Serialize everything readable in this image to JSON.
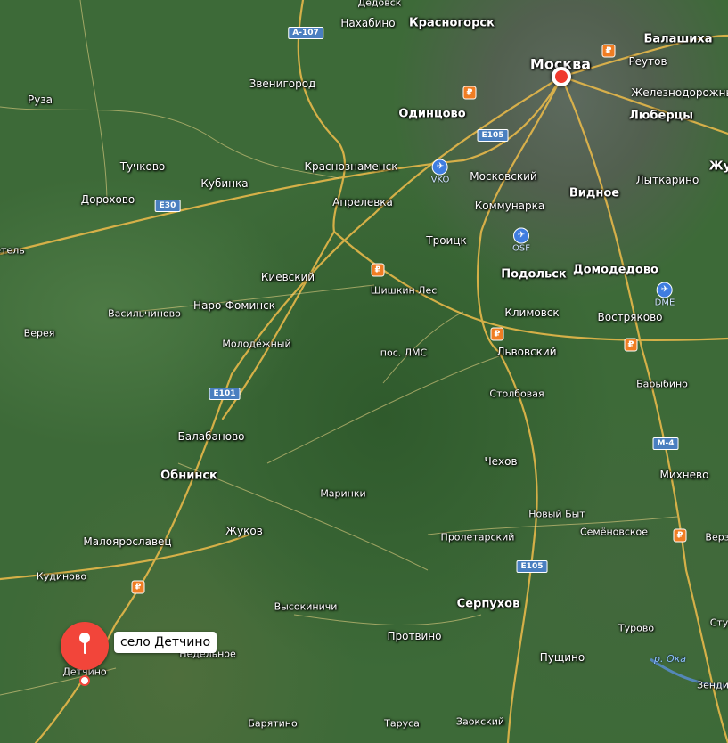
{
  "map": {
    "callout_label": "село Детчино",
    "river_label": "р. Ока",
    "places": [
      {
        "key": "dedovsk",
        "name": "Дедовск",
        "cls": "sm"
      },
      {
        "key": "nakhabino",
        "name": "Нахабино",
        "cls": "sm"
      },
      {
        "key": "krasnogorsk",
        "name": "Красногорск",
        "cls": "big"
      },
      {
        "key": "moskva",
        "name": "Москва",
        "cls": "huge"
      },
      {
        "key": "balashikha",
        "name": "Балашиха",
        "cls": "big"
      },
      {
        "key": "reutov",
        "name": "Реутов",
        "cls": ""
      },
      {
        "key": "zheleznodorozhny",
        "name": "Железнодорожный",
        "cls": ""
      },
      {
        "key": "lyubertsy",
        "name": "Люберцы",
        "cls": "big"
      },
      {
        "key": "zhuk",
        "name": "Жу",
        "cls": "big"
      },
      {
        "key": "ruza",
        "name": "Руза",
        "cls": ""
      },
      {
        "key": "zvenigorod",
        "name": "Звенигород",
        "cls": ""
      },
      {
        "key": "odintsovo",
        "name": "Одинцово",
        "cls": "big"
      },
      {
        "key": "tuchkovo",
        "name": "Тучково",
        "cls": ""
      },
      {
        "key": "krasnoznamensk",
        "name": "Краснознаменск",
        "cls": ""
      },
      {
        "key": "moskovsky",
        "name": "Московский",
        "cls": ""
      },
      {
        "key": "vidnoe",
        "name": "Видное",
        "cls": "big"
      },
      {
        "key": "lytkarino",
        "name": "Лыткарино",
        "cls": ""
      },
      {
        "key": "dorokhovo",
        "name": "Дорохово",
        "cls": ""
      },
      {
        "key": "kubinka",
        "name": "Кубинка",
        "cls": ""
      },
      {
        "key": "aprelevka",
        "name": "Апрелевка",
        "cls": ""
      },
      {
        "key": "kommunarka",
        "name": "Коммунарка",
        "cls": ""
      },
      {
        "key": "etel",
        "name": "етель",
        "cls": "sm"
      },
      {
        "key": "troitsk",
        "name": "Троицк",
        "cls": ""
      },
      {
        "key": "podolsk",
        "name": "Подольск",
        "cls": "big"
      },
      {
        "key": "domodedovo",
        "name": "Домодедово",
        "cls": "big"
      },
      {
        "key": "kievsky",
        "name": "Киевский",
        "cls": ""
      },
      {
        "key": "shishkin_les",
        "name": "Шишкин Лес",
        "cls": "sm"
      },
      {
        "key": "vasilchinovo",
        "name": "Васильчиново",
        "cls": "sm"
      },
      {
        "key": "naro_fominsk",
        "name": "Наро-Фоминск",
        "cls": ""
      },
      {
        "key": "klimovsk",
        "name": "Климовск",
        "cls": ""
      },
      {
        "key": "vostryakovo",
        "name": "Востряково",
        "cls": ""
      },
      {
        "key": "vereya",
        "name": "Верея",
        "cls": "sm"
      },
      {
        "key": "molodezhny",
        "name": "Молодёжный",
        "cls": "sm"
      },
      {
        "key": "pos_lms",
        "name": "пос. ЛМС",
        "cls": "sm"
      },
      {
        "key": "lvovsky",
        "name": "Львовский",
        "cls": ""
      },
      {
        "key": "barybino",
        "name": "Барыбино",
        "cls": "sm"
      },
      {
        "key": "stolbovaya",
        "name": "Столбовая",
        "cls": "sm"
      },
      {
        "key": "balabanovo",
        "name": "Балабаново",
        "cls": ""
      },
      {
        "key": "chekhov",
        "name": "Чехов",
        "cls": ""
      },
      {
        "key": "obninsk",
        "name": "Обнинск",
        "cls": "big"
      },
      {
        "key": "mikhnevo",
        "name": "Михнево",
        "cls": ""
      },
      {
        "key": "marinki",
        "name": "Маринки",
        "cls": "sm"
      },
      {
        "key": "novy_byt",
        "name": "Новый Быт",
        "cls": "sm"
      },
      {
        "key": "zhukov",
        "name": "Жуков",
        "cls": ""
      },
      {
        "key": "semenovskoe",
        "name": "Семёновское",
        "cls": "sm"
      },
      {
        "key": "verz",
        "name": "Верз",
        "cls": "sm"
      },
      {
        "key": "maloyaroslavets",
        "name": "Малоярославец",
        "cls": ""
      },
      {
        "key": "proletarsky",
        "name": "Пролетарский",
        "cls": "sm"
      },
      {
        "key": "kudinovo",
        "name": "Кудиново",
        "cls": "sm"
      },
      {
        "key": "serpukhov",
        "name": "Серпухов",
        "cls": "big"
      },
      {
        "key": "vysokinichi",
        "name": "Высокиничи",
        "cls": "sm"
      },
      {
        "key": "stup",
        "name": "Сту",
        "cls": "sm"
      },
      {
        "key": "turovo",
        "name": "Турово",
        "cls": "sm"
      },
      {
        "key": "protvino",
        "name": "Протвино",
        "cls": ""
      },
      {
        "key": "nedelnoe",
        "name": "Недельное",
        "cls": "sm"
      },
      {
        "key": "detchino",
        "name": "Детчино",
        "cls": "sm"
      },
      {
        "key": "pushchino",
        "name": "Пущино",
        "cls": ""
      },
      {
        "key": "zendi",
        "name": "Зенди",
        "cls": "sm"
      },
      {
        "key": "barjatino",
        "name": "Барятино",
        "cls": "sm"
      },
      {
        "key": "tarusa",
        "name": "Таруса",
        "cls": "sm"
      },
      {
        "key": "zaoksky",
        "name": "Заокский",
        "cls": "sm"
      }
    ],
    "road_shields": [
      "А-107",
      "Е105",
      "Е30",
      "Е101",
      "М-4",
      "Е105"
    ],
    "airports": [
      "VKO",
      "OSF",
      "DME"
    ],
    "fuel_symbol": "₽"
  }
}
